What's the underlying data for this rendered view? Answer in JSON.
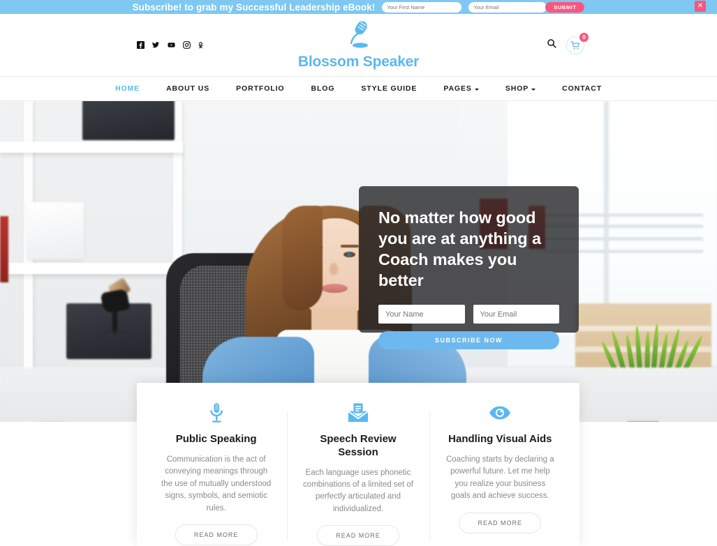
{
  "topbar": {
    "message": "Subscribe! to grab my Successful Leadership eBook!",
    "first_name_placeholder": "Your First Name",
    "first_name_value": "",
    "email_placeholder": "Your Email",
    "email_value": "",
    "submit_label": "SUBMIT",
    "close_label": "✕",
    "background_color": "#7ec8f2",
    "accent_color": "#f9577f"
  },
  "header": {
    "brand_name": "Blossom Speaker",
    "brand_color": "#5ab8f0",
    "social": [
      {
        "name": "facebook-icon",
        "label": "Facebook"
      },
      {
        "name": "twitter-icon",
        "label": "Twitter"
      },
      {
        "name": "youtube-icon",
        "label": "YouTube"
      },
      {
        "name": "instagram-icon",
        "label": "Instagram"
      },
      {
        "name": "odnoklassniki-icon",
        "label": "Odnoklassniki"
      }
    ],
    "search_label": "Search",
    "cart_label": "Cart",
    "cart_count": "0"
  },
  "nav": {
    "items": [
      {
        "label": "HOME",
        "active": true,
        "dropdown": false
      },
      {
        "label": "ABOUT US",
        "active": false,
        "dropdown": false
      },
      {
        "label": "PORTFOLIO",
        "active": false,
        "dropdown": false
      },
      {
        "label": "BLOG",
        "active": false,
        "dropdown": false
      },
      {
        "label": "STYLE GUIDE",
        "active": false,
        "dropdown": false
      },
      {
        "label": "PAGES",
        "active": false,
        "dropdown": true
      },
      {
        "label": "SHOP",
        "active": false,
        "dropdown": true
      },
      {
        "label": "CONTACT",
        "active": false,
        "dropdown": false
      }
    ]
  },
  "hero": {
    "title": "No matter how good you are at anything a Coach makes you better",
    "name_placeholder": "Your Name",
    "name_value": "",
    "email_placeholder": "Your Email",
    "email_value": "",
    "button_label": "SUBSCRIBE NOW",
    "button_color": "#6db9ef",
    "overlay_color": "rgba(38,38,40,0.80)"
  },
  "features": [
    {
      "icon": "microphone-icon",
      "title": "Public Speaking",
      "description": "Communication is the act of conveying meanings through the use of mutually understood signs, symbols, and semiotic rules.",
      "button_label": "READ MORE"
    },
    {
      "icon": "envelope-document-icon",
      "title": "Speech Review Session",
      "description": "Each language uses phonetic combinations of a limited set of perfectly articulated and individualized.",
      "button_label": "READ MORE"
    },
    {
      "icon": "eye-icon",
      "title": "Handling Visual Aids",
      "description": "Coaching starts by declaring a powerful future. Let me help you realize your business goals and achieve success.",
      "button_label": "READ MORE"
    }
  ]
}
